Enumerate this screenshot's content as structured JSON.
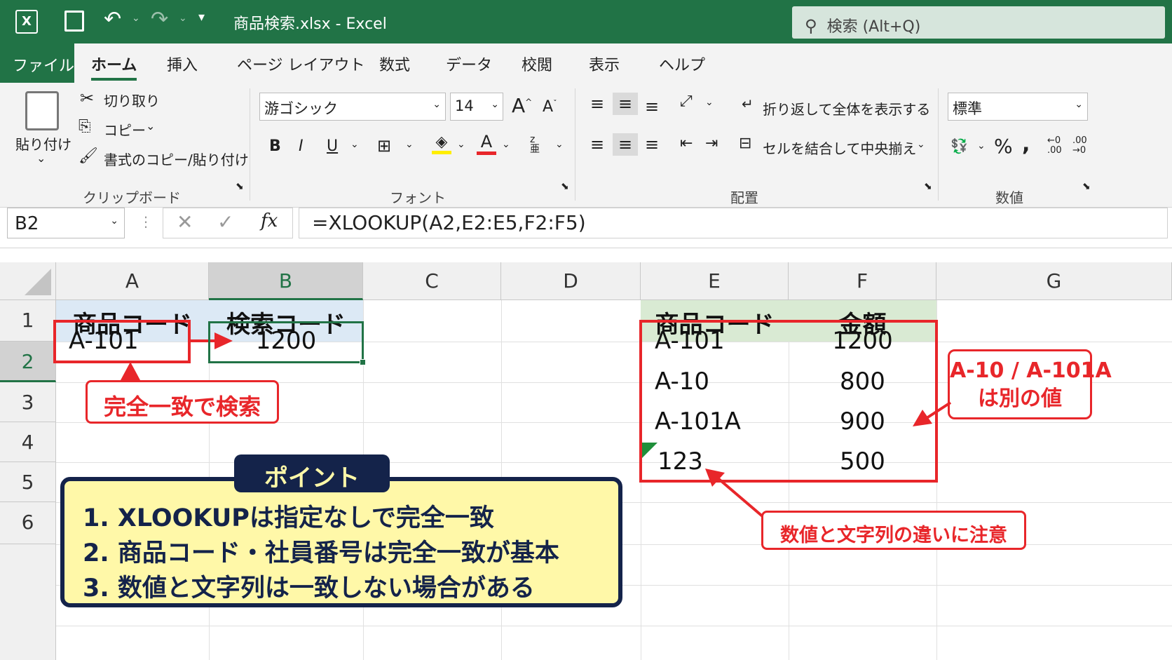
{
  "titlebar": {
    "title": "商品検索.xlsx  -  Excel",
    "search": "検索 (Alt+Q)"
  },
  "tabs": [
    "ファイル",
    "ホーム",
    "挿入",
    "ページ レイアウト",
    "数式",
    "データ",
    "校閲",
    "表示",
    "ヘルプ"
  ],
  "ribbon": {
    "clipboard": {
      "paste": "貼り付け",
      "cut": "切り取り",
      "copy": "コピー",
      "format_painter": "書式のコピー/貼り付け",
      "group": "クリップボード"
    },
    "font": {
      "name": "游ゴシック",
      "size": "14",
      "group": "フォント"
    },
    "alignment": {
      "wrap": "折り返して全体を表示する",
      "merge": "セルを結合して中央揃え",
      "group": "配置"
    },
    "number": {
      "format": "標準",
      "group": "数値"
    }
  },
  "formula_bar": {
    "name_box": "B2",
    "formula": "=XLOOKUP(A2,E2:E5,F2:F5)"
  },
  "columns": [
    "A",
    "B",
    "C",
    "D",
    "E",
    "F",
    "G"
  ],
  "rows": [
    "1",
    "2",
    "3",
    "4",
    "5",
    "6"
  ],
  "cells": {
    "A1": "商品コード",
    "B1": "検索コード",
    "A2": "A-101",
    "B2": "1200",
    "E1": "商品コード",
    "F1": "金額",
    "E2": "A-101",
    "F2": "1200",
    "E3": "A-10",
    "F3": "800",
    "E4": "A-101A",
    "F4": "900",
    "E5": "123",
    "F5": "500"
  },
  "callouts": {
    "exact": "完全一致で検索",
    "diff_line1": "A-10 / A-101A",
    "diff_line2": "は別の値",
    "numeric": "数値と文字列の違いに注意"
  },
  "point": {
    "title": "ポイント",
    "items": [
      "1. XLOOKUPは指定なしで完全一致",
      "2. 商品コード・社員番号は完全一致が基本",
      "3. 数値と文字列は一致しない場合がある"
    ]
  },
  "colors": {
    "excel_green": "#217346",
    "red": "#e8262a",
    "header_blue": "#dce9f5",
    "header_green": "#d9ead3",
    "point_navy": "#14234a",
    "point_yellow": "#fff8a8"
  }
}
